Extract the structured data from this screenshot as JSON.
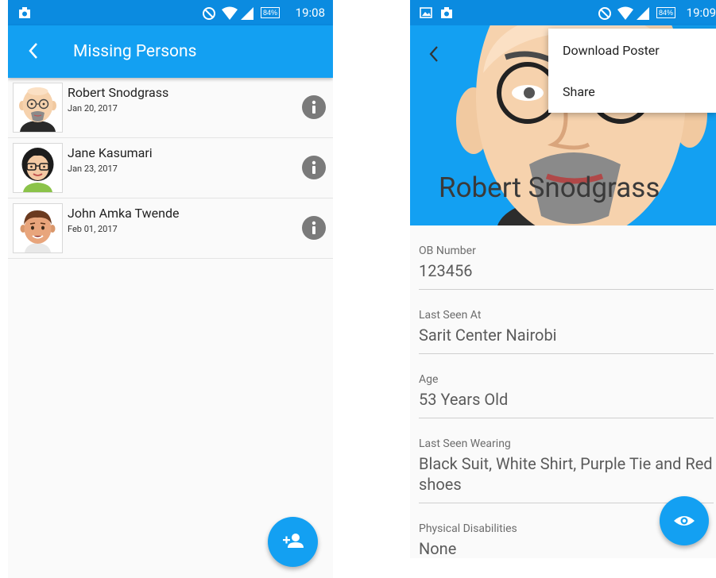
{
  "colors": {
    "primary": "#13a0f2",
    "status_bar": "#0b8be0",
    "info_icon": "#7a7a7a"
  },
  "left_screen": {
    "status_time": "19:08",
    "battery": "84%",
    "title": "Missing Persons",
    "persons": [
      {
        "name": "Robert Snodgrass",
        "date": "Jan 20, 2017",
        "avatar": "bald-glasses-goatee-avatar"
      },
      {
        "name": "Jane Kasumari",
        "date": "Jan 23, 2017",
        "avatar": "woman-glasses-avatar"
      },
      {
        "name": "John Amka Twende",
        "date": "Feb 01, 2017",
        "avatar": "young-man-avatar"
      }
    ],
    "fab_icon": "add-person-icon"
  },
  "right_screen": {
    "status_time": "19:09",
    "battery": "84%",
    "hero_name": "Robert Snodgrass",
    "menu": [
      "Download Poster",
      "Share"
    ],
    "fields": [
      {
        "label": "OB Number",
        "value": "123456"
      },
      {
        "label": "Last Seen At",
        "value": "Sarit Center Nairobi"
      },
      {
        "label": "Age",
        "value": "53 Years Old"
      },
      {
        "label": "Last Seen Wearing",
        "value": "Black Suit, White Shirt, Purple Tie and Red shoes"
      },
      {
        "label": "Physical Disabilities",
        "value": "None"
      }
    ],
    "fab_icon": "eye-icon"
  }
}
